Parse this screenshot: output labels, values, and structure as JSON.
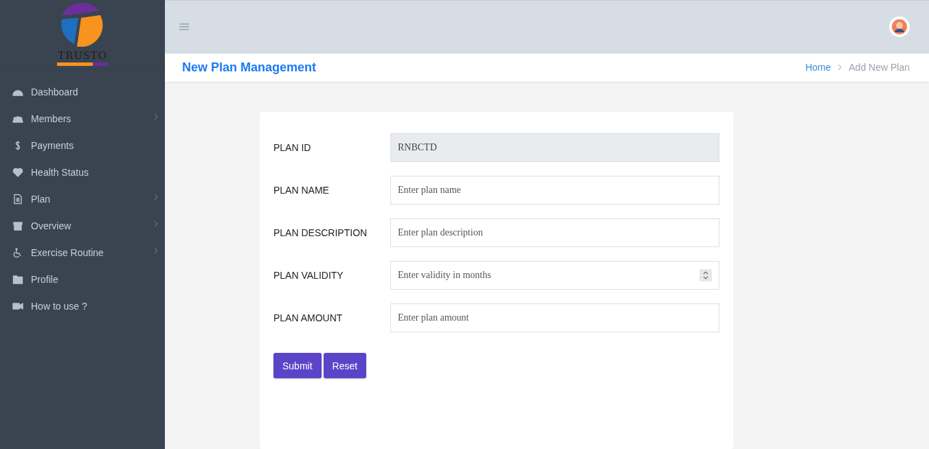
{
  "logo": {
    "text": "TRUSTO"
  },
  "sidebar": {
    "items": [
      {
        "label": "Dashboard",
        "has_submenu": false
      },
      {
        "label": "Members",
        "has_submenu": true
      },
      {
        "label": "Payments",
        "has_submenu": false
      },
      {
        "label": "Health Status",
        "has_submenu": false
      },
      {
        "label": "Plan",
        "has_submenu": true
      },
      {
        "label": "Overview",
        "has_submenu": true
      },
      {
        "label": "Exercise Routine",
        "has_submenu": true
      },
      {
        "label": "Profile",
        "has_submenu": false
      },
      {
        "label": "How to use ?",
        "has_submenu": false
      }
    ]
  },
  "page_title": "New Plan Management",
  "breadcrumb": [
    {
      "label": "Home",
      "selected": false
    },
    {
      "label": "Add New Plan",
      "selected": true
    }
  ],
  "form": {
    "fields": [
      {
        "label": "PLAN ID",
        "kind": "readonly",
        "value": "RNBCTD"
      },
      {
        "label": "PLAN NAME",
        "kind": "text",
        "placeholder": "Enter plan name"
      },
      {
        "label": "PLAN DESCRIPTION",
        "kind": "text",
        "placeholder": "Enter plan description"
      },
      {
        "label": "PLAN VALIDITY",
        "kind": "number",
        "placeholder": "Enter validity in months"
      },
      {
        "label": "PLAN AMOUNT",
        "kind": "text",
        "placeholder": "Enter plan amount"
      }
    ],
    "buttons": [
      "Submit",
      "Reset"
    ]
  }
}
